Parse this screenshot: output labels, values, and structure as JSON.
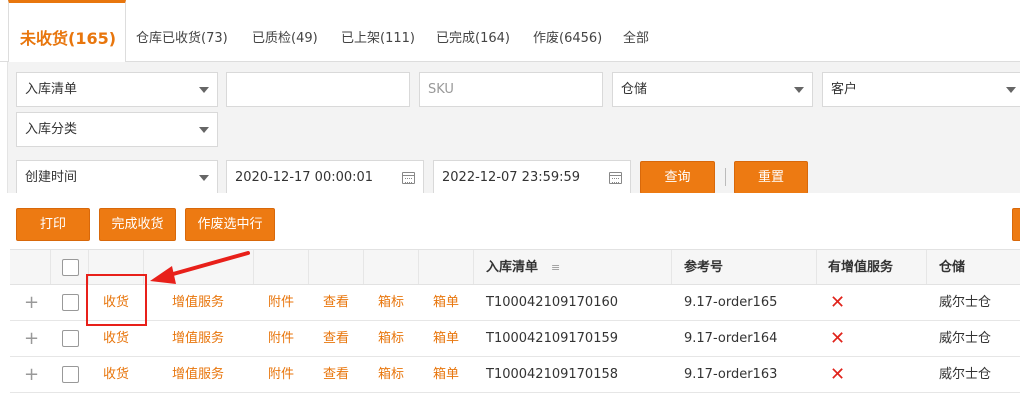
{
  "tabs": [
    {
      "label": "未收货(165)",
      "active": true
    },
    {
      "label": "仓库已收货(73)"
    },
    {
      "label": "已质检(49)"
    },
    {
      "label": "已上架(111)"
    },
    {
      "label": "已完成(164)"
    },
    {
      "label": "作废(6456)"
    },
    {
      "label": "全部"
    }
  ],
  "filters": {
    "inbound_list_select": "入库清单",
    "inbound_list_input": "",
    "sku_placeholder": "SKU",
    "warehouse_select": "仓储",
    "customer_select": "客户",
    "inbound_category_select": "入库分类",
    "time_type_select": "创建时间",
    "start_time": "2020-12-17 00:00:01",
    "end_time": "2022-12-07 23:59:59",
    "query_label": "查询",
    "reset_label": "重置"
  },
  "actions": {
    "print_label": "打印",
    "complete_receive_label": "完成收货",
    "void_selected_label": "作废选中行"
  },
  "table": {
    "headers": {
      "inbound_list": "入库清单",
      "reference": "参考号",
      "value_added": "有增值服务",
      "warehouse": "仓储"
    },
    "rows": [
      {
        "expand": "+",
        "receive": "收货",
        "vas": "增值服务",
        "attachment": "附件",
        "view": "查看",
        "box_label": "箱标",
        "box_list": "箱单",
        "inbound_list": "T100042109170160",
        "reference": "9.17-order165",
        "value_added": "✕",
        "warehouse": "威尔士仓"
      },
      {
        "expand": "+",
        "receive": "收货",
        "vas": "增值服务",
        "attachment": "附件",
        "view": "查看",
        "box_label": "箱标",
        "box_list": "箱单",
        "inbound_list": "T100042109170159",
        "reference": "9.17-order164",
        "value_added": "✕",
        "warehouse": "威尔士仓"
      },
      {
        "expand": "+",
        "receive": "收货",
        "vas": "增值服务",
        "attachment": "附件",
        "view": "查看",
        "box_label": "箱标",
        "box_list": "箱单",
        "inbound_list": "T100042109170158",
        "reference": "9.17-order163",
        "value_added": "✕",
        "warehouse": "威尔士仓"
      }
    ]
  },
  "colors": {
    "accent": "#ed7a12",
    "annotation_red": "#e8201a",
    "no_mark": "#e0231b"
  }
}
